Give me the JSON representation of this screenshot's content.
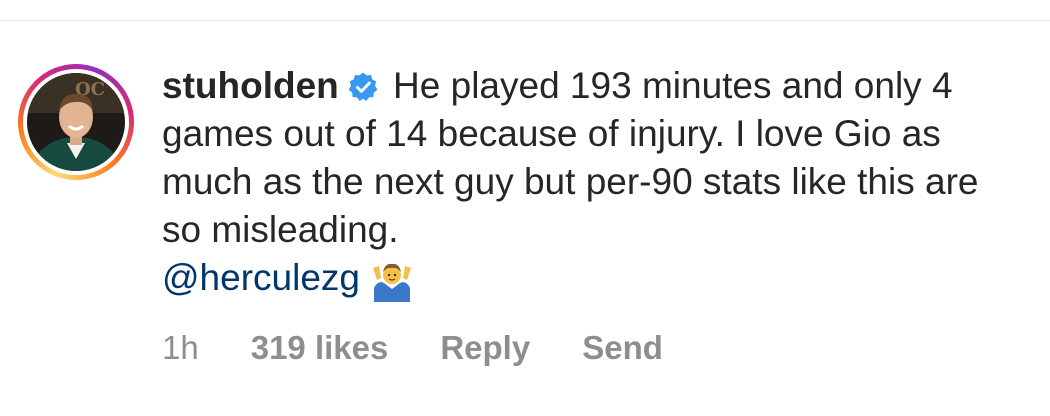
{
  "comment": {
    "username": "stuholden",
    "text": "He played 193 minutes and only 4 games out of 14 because of injury. I love Gio as much as the next guy but per-90 stats like this are so misleading.",
    "mention": "@herculezg",
    "emoji": "🤷‍♂️"
  },
  "meta": {
    "time": "1h",
    "likes": "319 likes",
    "reply": "Reply",
    "send": "Send"
  },
  "colors": {
    "text": "#262626",
    "secondary": "#8e8e8e",
    "mention": "#00376b",
    "verified": "#3897f0"
  },
  "icons": {
    "verified": "verified-badge-icon",
    "emoji": "shrug-emoji-icon"
  }
}
